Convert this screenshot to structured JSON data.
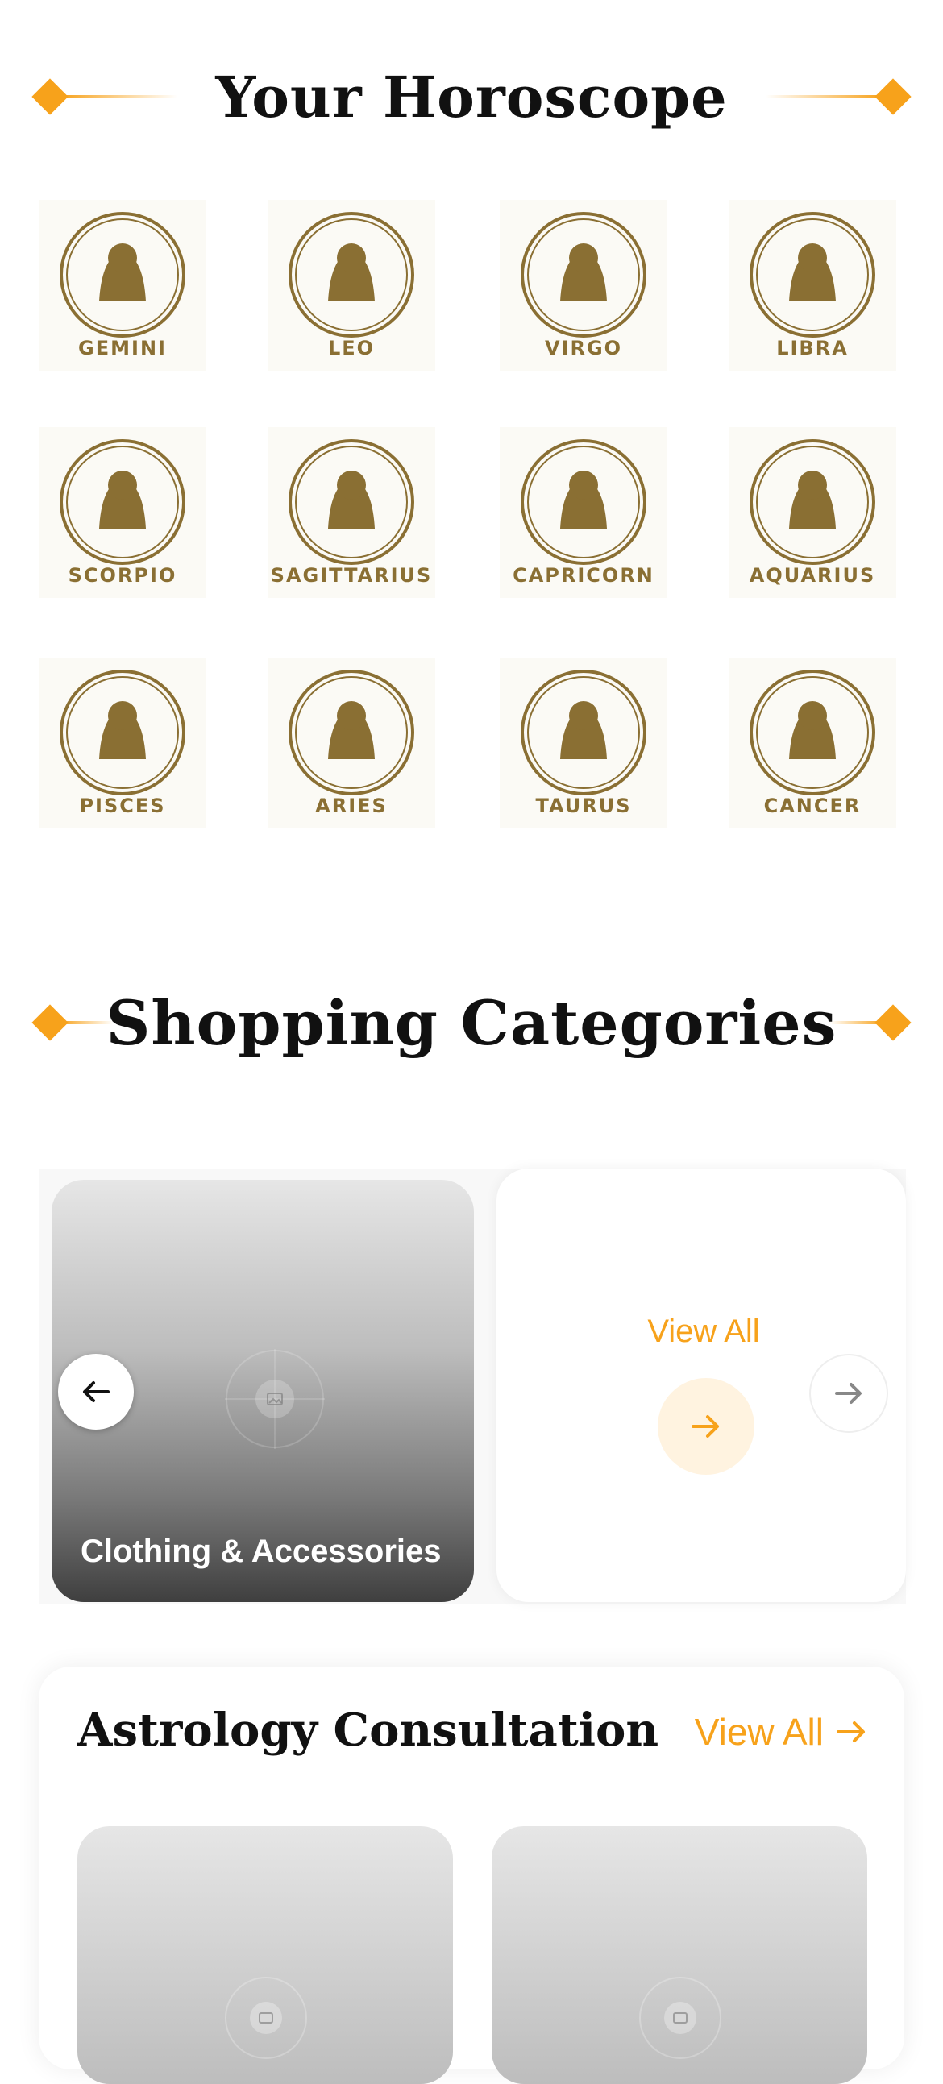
{
  "horoscope": {
    "title": "Your Horoscope",
    "signs": [
      {
        "name": "GEMINI",
        "icon": "gemini-icon"
      },
      {
        "name": "LEO",
        "icon": "leo-icon"
      },
      {
        "name": "VIRGO",
        "icon": "virgo-icon"
      },
      {
        "name": "LIBRA",
        "icon": "libra-icon"
      },
      {
        "name": "SCORPIO",
        "icon": "scorpio-icon"
      },
      {
        "name": "SAGITTARIUS",
        "icon": "sagittarius-icon"
      },
      {
        "name": "CAPRICORN",
        "icon": "capricorn-icon"
      },
      {
        "name": "AQUARIUS",
        "icon": "aquarius-icon"
      },
      {
        "name": "PISCES",
        "icon": "pisces-icon"
      },
      {
        "name": "ARIES",
        "icon": "aries-icon"
      },
      {
        "name": "TAURUS",
        "icon": "taurus-icon"
      },
      {
        "name": "CANCER",
        "icon": "cancer-icon"
      }
    ]
  },
  "shopping": {
    "title": "Shopping Categories",
    "categories": [
      {
        "label": "Clothing & Accessories"
      }
    ],
    "view_all_label": "View All"
  },
  "consultation": {
    "title": "Astrology Consultation",
    "view_all_label": "View All"
  },
  "colors": {
    "accent": "#f7a21b",
    "zodiac_gold": "#8a6f33"
  }
}
